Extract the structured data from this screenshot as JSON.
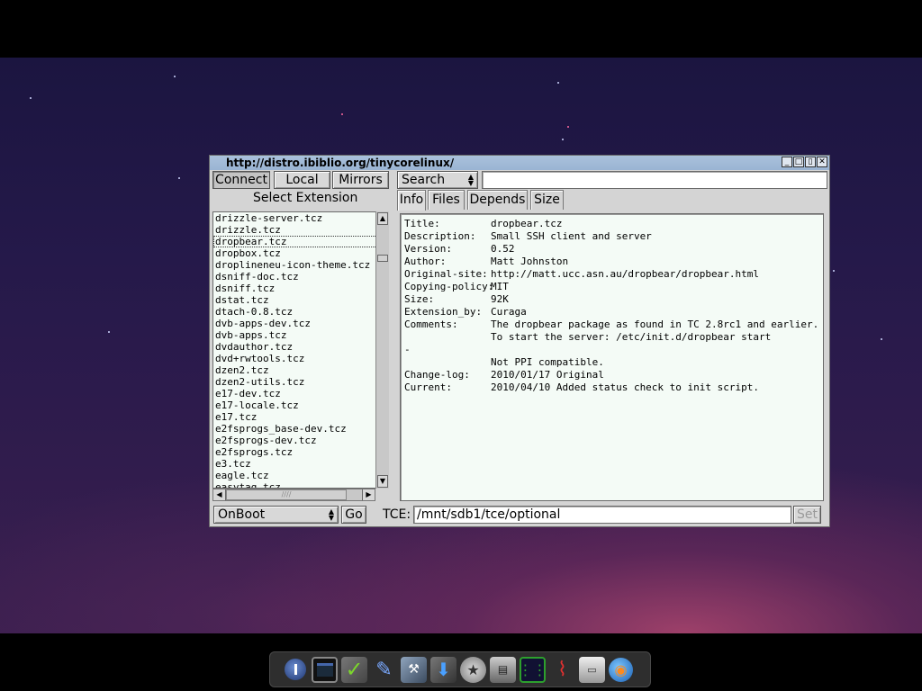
{
  "window": {
    "title": "http://distro.ibiblio.org/tinycorelinux/",
    "controls": [
      "_",
      "□",
      "▯",
      "✕"
    ]
  },
  "toolbar": {
    "connect_label": "Connect",
    "local_label": "Local",
    "mirrors_label": "Mirrors",
    "search_mode": "Search",
    "search_value": ""
  },
  "left_panel": {
    "heading": "Select Extension",
    "extensions": [
      "drizzle-server.tcz",
      "drizzle.tcz",
      "dropbear.tcz",
      "dropbox.tcz",
      "droplineneu-icon-theme.tcz",
      "dsniff-doc.tcz",
      "dsniff.tcz",
      "dstat.tcz",
      "dtach-0.8.tcz",
      "dvb-apps-dev.tcz",
      "dvb-apps.tcz",
      "dvdauthor.tcz",
      "dvd+rwtools.tcz",
      "dzen2.tcz",
      "dzen2-utils.tcz",
      "e17-dev.tcz",
      "e17-locale.tcz",
      "e17.tcz",
      "e2fsprogs_base-dev.tcz",
      "e2fsprogs-dev.tcz",
      "e2fsprogs.tcz",
      "e3.tcz",
      "eagle.tcz",
      "easytag.tcz"
    ],
    "selected": "dropbear.tcz"
  },
  "tabs": [
    "Info",
    "Files",
    "Depends",
    "Size"
  ],
  "active_tab": "Info",
  "info": {
    "lines": [
      {
        "key": "Title:",
        "value": "dropbear.tcz"
      },
      {
        "key": "Description:",
        "value": "Small SSH client and server"
      },
      {
        "key": "Version:",
        "value": "0.52"
      },
      {
        "key": "Author:",
        "value": "Matt Johnston"
      },
      {
        "key": "Original-site:",
        "value": "http://matt.ucc.asn.au/dropbear/dropbear.html"
      },
      {
        "key": "Copying-policy:",
        "value": "MIT"
      },
      {
        "key": "Size:",
        "value": "92K"
      },
      {
        "key": "Extension_by:",
        "value": "Curaga"
      },
      {
        "key": "Comments:",
        "value": "The dropbear package as found in TC 2.8rc1 and earlier."
      },
      {
        "key": "",
        "value": "To start the server: /etc/init.d/dropbear start"
      },
      {
        "key": "-",
        "value": ""
      },
      {
        "key": "",
        "value": "Not PPI compatible."
      },
      {
        "key": "Change-log:",
        "value": "2010/01/17 Original"
      },
      {
        "key": "Current:",
        "value": "2010/04/10 Added status check to init script."
      }
    ]
  },
  "bottom": {
    "install_mode": "OnBoot",
    "go_label": "Go",
    "tce_label": "TCE:",
    "tce_path": "/mnt/sdb1/tce/optional",
    "set_label": "Set"
  },
  "dock": {
    "icons": [
      "power-icon",
      "terminal-icon",
      "apps-check-icon",
      "brush-icon",
      "tools-icon",
      "download-icon",
      "run-icon",
      "drive-icon",
      "network-monitor-icon",
      "wifi-icon",
      "sd-card-icon",
      "browser-globe-icon"
    ]
  }
}
